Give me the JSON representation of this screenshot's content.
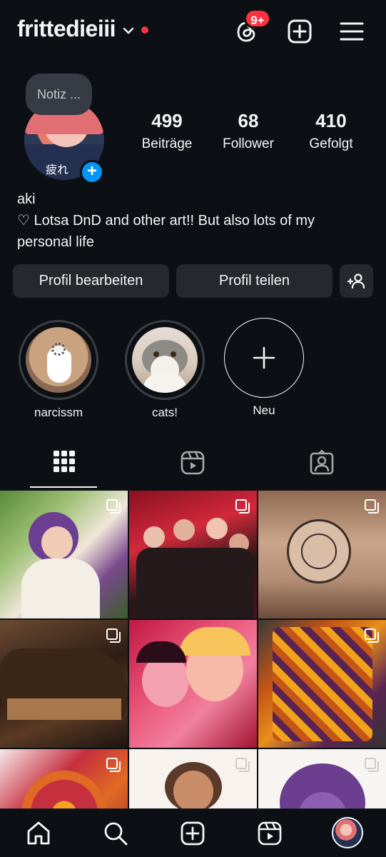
{
  "header": {
    "username": "frittedieiii",
    "notification_badge": "9+",
    "accent_color": "#ff3040"
  },
  "profile": {
    "note_placeholder": "Notiz ...",
    "stats": [
      {
        "value": "499",
        "label": "Beiträge"
      },
      {
        "value": "68",
        "label": "Follower"
      },
      {
        "value": "410",
        "label": "Gefolgt"
      }
    ],
    "name": "aki",
    "bio": "♡ Lotsa DnD and other art!! But also lots of my personal life"
  },
  "actions": {
    "edit_label": "Profil bearbeiten",
    "share_label": "Profil teilen"
  },
  "highlights": [
    {
      "label": "narcissm"
    },
    {
      "label": "cats!"
    },
    {
      "label": "Neu"
    }
  ],
  "tabs": [
    {
      "icon": "grid-icon",
      "active": true
    },
    {
      "icon": "reels-icon",
      "active": false
    },
    {
      "icon": "tagged-icon",
      "active": false
    }
  ],
  "nav": [
    "home-icon",
    "search-icon",
    "create-icon",
    "reels-icon",
    "profile-avatar"
  ]
}
